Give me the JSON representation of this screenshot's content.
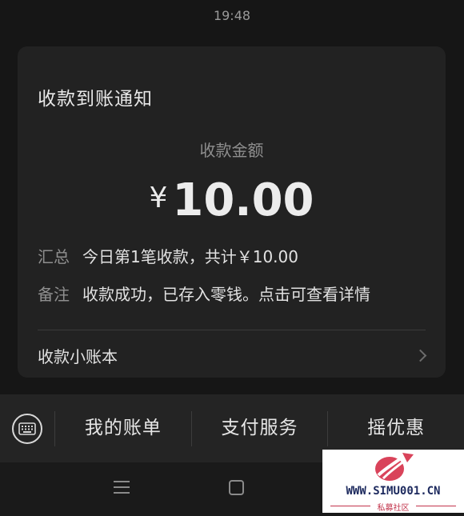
{
  "status_bar": {
    "time": "19:48"
  },
  "card": {
    "title": "收款到账通知",
    "amount_label": "收款金额",
    "currency": "¥",
    "amount": "10.00",
    "summary_key": "汇总",
    "summary_value": "今日第1笔收款，共计￥10.00",
    "note_key": "备注",
    "note_value": "收款成功，已存入零钱。点击可查看详情",
    "ledger_label": "收款小账本"
  },
  "bottom_menu": {
    "items": [
      {
        "label": "我的账单"
      },
      {
        "label": "支付服务"
      },
      {
        "label": "摇优惠"
      }
    ]
  },
  "watermark": {
    "text": "WWW.SIMU001.CN",
    "subtext": "私募社区"
  },
  "colors": {
    "background": "#161616",
    "card": "#222222",
    "menu": "#242424",
    "watermark_brand": "#c2334b"
  },
  "icons": [
    "keyboard-icon",
    "chevron-right-icon",
    "nav-menu-icon",
    "nav-home-icon",
    "watermark-logo-icon"
  ]
}
